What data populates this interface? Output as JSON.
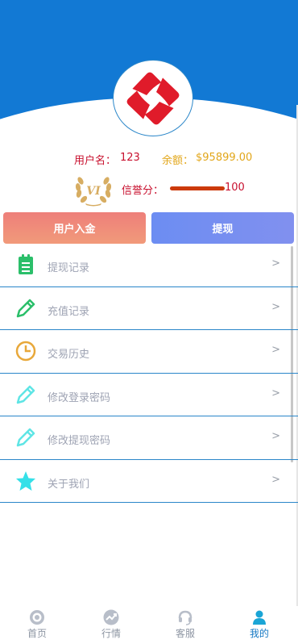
{
  "user": {
    "name_label": "用户名：",
    "name_value": "123",
    "balance_label": "余额：",
    "balance_value": "$95899.00"
  },
  "vip": {
    "level_text": "VI"
  },
  "credit": {
    "label": "信誉分：",
    "value": "100"
  },
  "actions": {
    "deposit_label": "用户入金",
    "withdraw_label": "提现"
  },
  "menu": [
    {
      "label": "提现记录",
      "icon": "clipboard-list-icon",
      "arrow": ">"
    },
    {
      "label": "充值记录",
      "icon": "pencil-icon",
      "arrow": ">"
    },
    {
      "label": "交易历史",
      "icon": "clock-icon",
      "arrow": ">"
    },
    {
      "label": "修改登录密码",
      "icon": "pencil-icon",
      "arrow": ">"
    },
    {
      "label": "修改提现密码",
      "icon": "pencil-icon",
      "arrow": ">"
    },
    {
      "label": "关于我们",
      "icon": "star-icon",
      "arrow": ">"
    }
  ],
  "tabbar": [
    {
      "label": "首页",
      "icon": "home-icon",
      "active": false
    },
    {
      "label": "行情",
      "icon": "trend-icon",
      "active": false
    },
    {
      "label": "客服",
      "icon": "headset-icon",
      "active": false
    },
    {
      "label": "我的",
      "icon": "user-icon",
      "active": true
    }
  ],
  "colors": {
    "header_blue": "#1279d4",
    "user_red": "#c8102e",
    "balance_gold": "#e2a619",
    "divider_blue": "#2a86c9",
    "active_tab": "#1679c4"
  }
}
